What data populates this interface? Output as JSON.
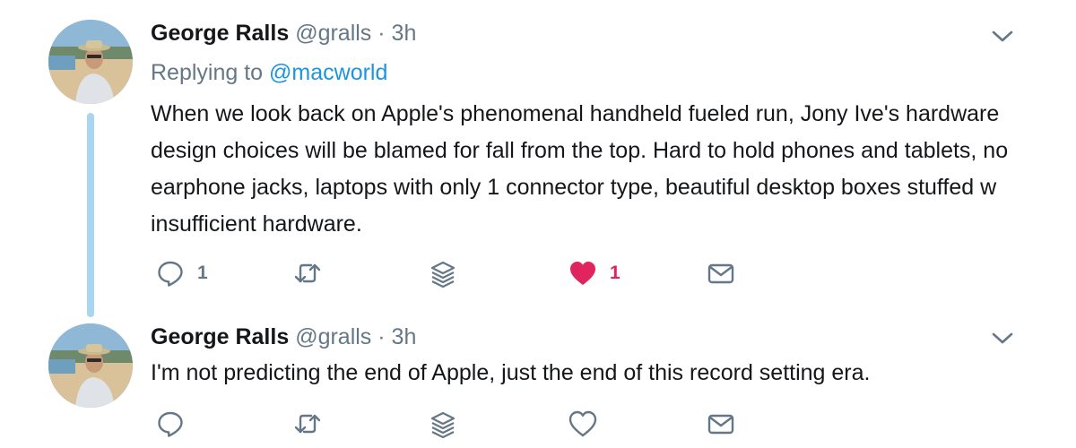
{
  "tweets": [
    {
      "author_name": "George Ralls",
      "handle": "@gralls",
      "separator": "·",
      "time": "3h",
      "replying_prefix": "Replying to",
      "replying_mention": "@macworld",
      "text": "When we look back on Apple's phenomenal handheld fueled run, Jony Ive's hardware design choices will be blamed for fall from the top. Hard to hold phones and tablets, no earphone jacks, laptops with only 1 connector type, beautiful desktop boxes stuffed w insufficient hardware.",
      "reply_count": "1",
      "retweet_count": "",
      "like_count": "1",
      "liked": true
    },
    {
      "author_name": "George Ralls",
      "handle": "@gralls",
      "separator": "·",
      "time": "3h",
      "text": "I'm not predicting the end of Apple, just the end of this record setting era.",
      "reply_count": "",
      "retweet_count": "",
      "like_count": "",
      "liked": false
    }
  ],
  "icons": {
    "reply": "reply-icon",
    "retweet": "retweet-icon",
    "stack": "stack-icon",
    "like": "heart-icon",
    "message": "envelope-icon",
    "more": "chevron-down-icon"
  },
  "colors": {
    "text": "#14171a",
    "secondary": "#657786",
    "link": "#1b95e0",
    "like": "#e0245e",
    "thread_line": "#a8d5f2"
  }
}
